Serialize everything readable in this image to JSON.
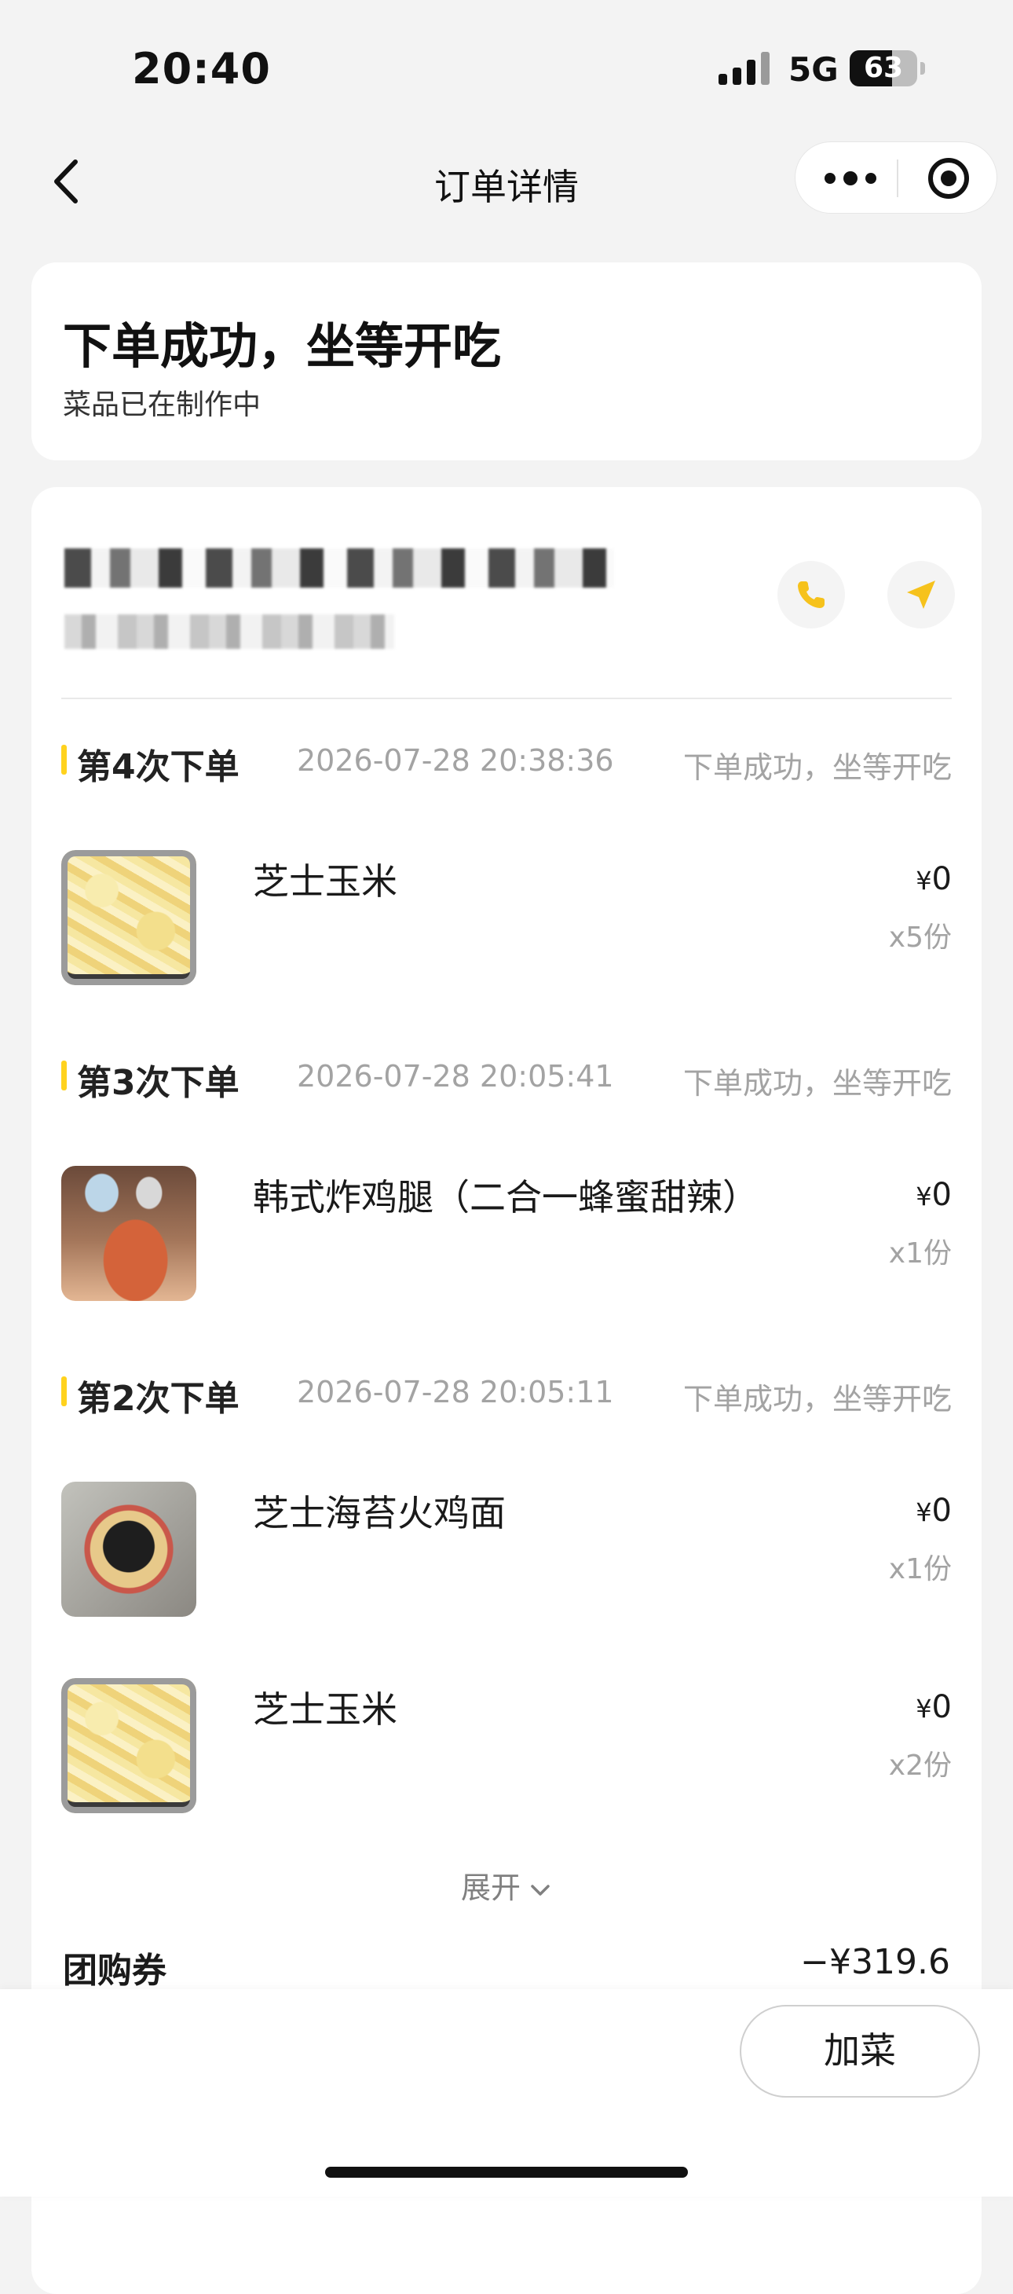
{
  "status_bar": {
    "time": "20:40",
    "network": "5G",
    "battery": "63",
    "battery_level": 0.63
  },
  "nav": {
    "title": "订单详情"
  },
  "order_status": {
    "title": "下单成功，坐等开吃",
    "subtitle": "菜品已在制作中"
  },
  "store": {
    "name_redacted": true
  },
  "batches": [
    {
      "label": "第4次下单",
      "time": "2026-07-28 20:38:36",
      "status": "下单成功，坐等开吃",
      "items": [
        {
          "name": "芝士玉米",
          "currency": "¥",
          "price": "0",
          "qty": "x5份",
          "thumb": "cheese-corn"
        }
      ]
    },
    {
      "label": "第3次下单",
      "time": "2026-07-28 20:05:41",
      "status": "下单成功，坐等开吃",
      "items": [
        {
          "name": "韩式炸鸡腿（二合一蜂蜜甜辣）",
          "currency": "¥",
          "price": "0",
          "qty": "x1份",
          "thumb": "fried-chicken"
        }
      ]
    },
    {
      "label": "第2次下单",
      "time": "2026-07-28 20:05:11",
      "status": "下单成功，坐等开吃",
      "items": [
        {
          "name": "芝士海苔火鸡面",
          "currency": "¥",
          "price": "0",
          "qty": "x1份",
          "thumb": "seaweed-noodle"
        },
        {
          "name": "芝士玉米",
          "currency": "¥",
          "price": "0",
          "qty": "x2份",
          "thumb": "cheese-corn"
        }
      ]
    }
  ],
  "expand": {
    "label": "展开"
  },
  "coupon": {
    "label": "团购券",
    "value": "−¥319.6"
  },
  "bottom": {
    "add_button": "加菜"
  },
  "colors": {
    "accent": "#ffd21e",
    "page_bg": "#f3f3f3",
    "muted_text": "#a3a3a3"
  }
}
